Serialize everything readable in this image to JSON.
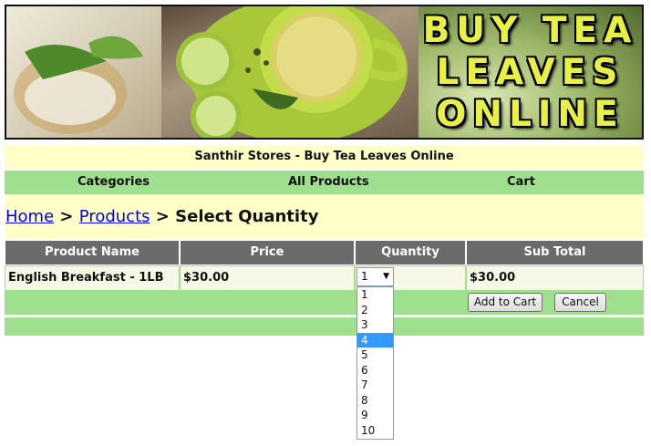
{
  "banner": {
    "text_line1": "BUY TEA",
    "text_line2": "LEAVES",
    "text_line3": "ONLINE"
  },
  "title": "Santhir Stores - Buy Tea Leaves Online",
  "nav": {
    "categories": "Categories",
    "all_products": "All Products",
    "cart": "Cart"
  },
  "breadcrumb": {
    "home": "Home",
    "sep1": " > ",
    "products": "Products",
    "sep2": " > ",
    "current": "Select Quantity"
  },
  "table": {
    "headers": [
      "Product Name",
      "Price",
      "Quantity",
      "Sub Total"
    ],
    "row": {
      "product": "English Breakfast - 1LB",
      "price": "$30.00",
      "quantity": "1",
      "subtotal": "$30.00"
    }
  },
  "buttons": {
    "add_to_cart": "Add to Cart",
    "cancel": "Cancel"
  },
  "quantity_dropdown": {
    "options": [
      "1",
      "2",
      "3",
      "4",
      "5",
      "6",
      "7",
      "8",
      "9",
      "10"
    ],
    "highlighted": "4"
  },
  "colors": {
    "nav_green": "#9fe08e",
    "title_yellow": "#ffffc8",
    "header_gray": "#6b6b6b",
    "highlight_blue": "#3399ff"
  }
}
